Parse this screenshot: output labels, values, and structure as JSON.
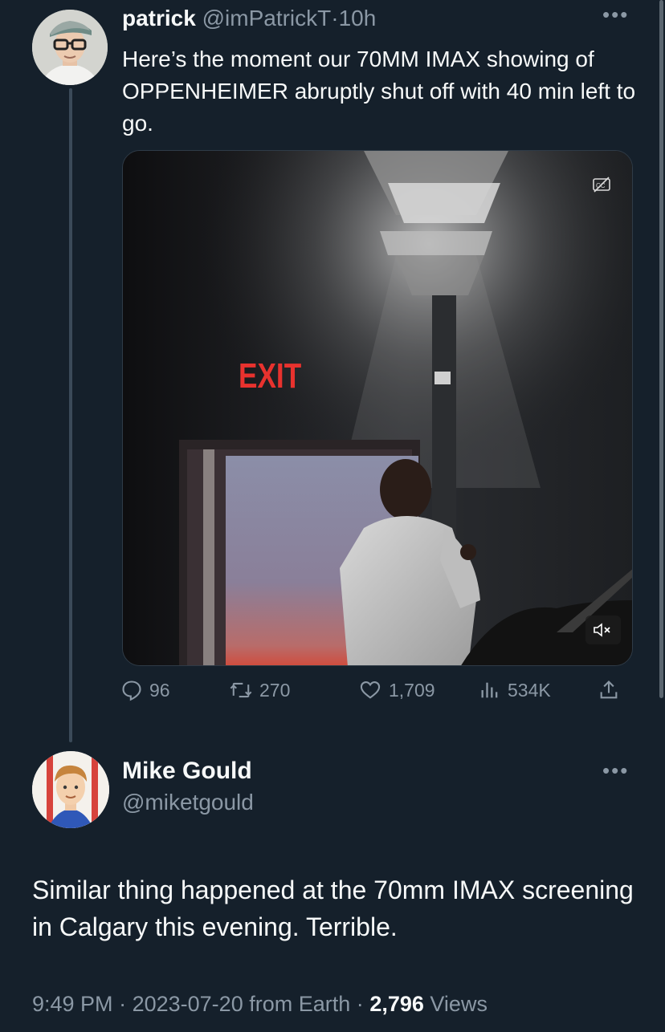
{
  "tweet": {
    "author_name": "patrick",
    "author_handle": "@imPatrickT",
    "separator": "·",
    "age": "10h",
    "text": "Here’s the moment our 70MM IMAX showing of OPPENHEIMER abruptly shut off with 40 min left to go.",
    "media": {
      "sign_text": "EXIT",
      "captions_icon": "captions-off-icon",
      "mute_icon": "muted-speaker-icon"
    },
    "stats": {
      "replies": "96",
      "retweets": "270",
      "likes": "1,709",
      "views": "534K"
    }
  },
  "reply": {
    "author_name": "Mike Gould",
    "author_handle": "@miketgould",
    "text": "Similar thing happened at the 70mm IMAX screening in Calgary this evening. Terrible.",
    "time": "9:49 PM",
    "date": "2023-07-20",
    "source": "from Earth",
    "separator": "·",
    "views_count": "2,796",
    "views_label": "Views"
  },
  "colors": {
    "background": "#15202b",
    "text_primary": "#f7f9f9",
    "text_secondary": "#8b98a5",
    "exit_sign": "#e8322e"
  }
}
